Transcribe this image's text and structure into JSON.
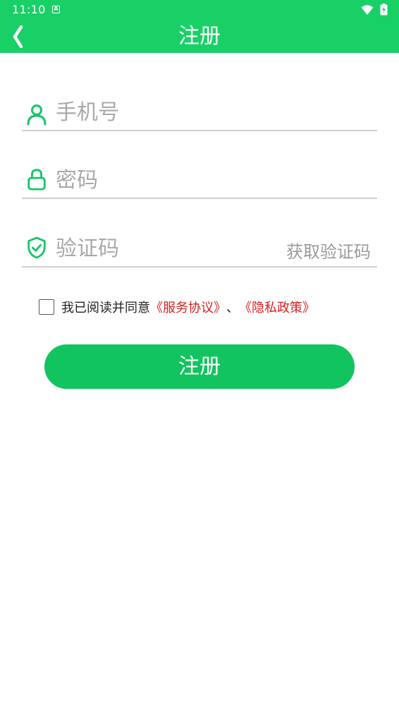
{
  "statusbar": {
    "time": "11:10",
    "notification_icon": "a-badge-icon",
    "wifi_icon": "wifi-icon",
    "battery_icon": "battery-charging-icon"
  },
  "header": {
    "back_icon": "chevron-left-icon",
    "title": "注册"
  },
  "form": {
    "phone": {
      "icon": "user-icon",
      "placeholder": "手机号",
      "value": ""
    },
    "password": {
      "icon": "lock-icon",
      "placeholder": "密码",
      "value": ""
    },
    "code": {
      "icon": "shield-check-icon",
      "placeholder": "验证码",
      "value": "",
      "get_code_label": "获取验证码"
    },
    "agreement": {
      "checked": false,
      "prefix": "我已阅读并同意",
      "service_link": "《服务协议》",
      "separator": "、",
      "privacy_link": "《隐私政策》"
    },
    "submit_label": "注册"
  },
  "colors": {
    "brand_green": "#19d067",
    "button_green": "#11c45f",
    "link_red": "#d81e1e",
    "placeholder_gray": "#a9a9a9",
    "divider_gray": "#cfcfcf"
  }
}
